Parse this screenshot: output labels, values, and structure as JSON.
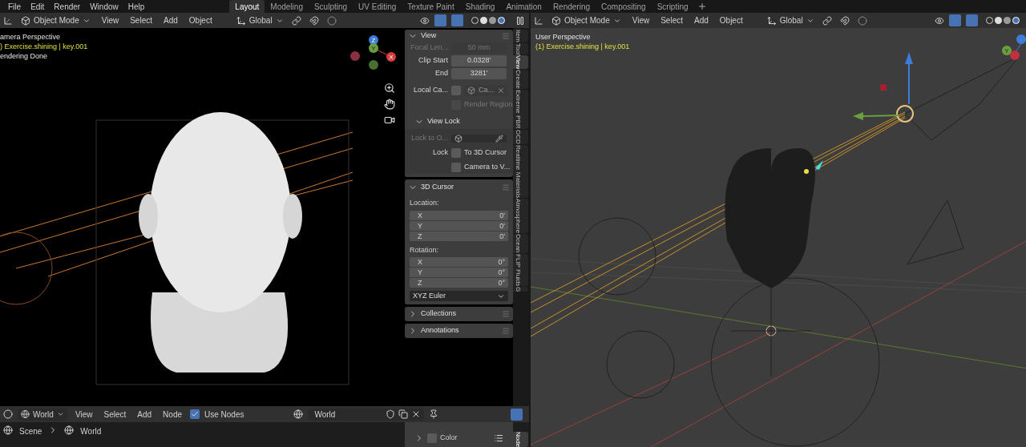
{
  "menu": [
    "File",
    "Edit",
    "Render",
    "Window",
    "Help"
  ],
  "workspaces": [
    {
      "label": "Layout",
      "selected": true
    },
    {
      "label": "Modeling",
      "selected": false
    },
    {
      "label": "Sculpting",
      "selected": false
    },
    {
      "label": "UV Editing",
      "selected": false
    },
    {
      "label": "Texture Paint",
      "selected": false
    },
    {
      "label": "Shading",
      "selected": false
    },
    {
      "label": "Animation",
      "selected": false
    },
    {
      "label": "Rendering",
      "selected": false
    },
    {
      "label": "Compositing",
      "selected": false
    },
    {
      "label": "Scripting",
      "selected": false
    }
  ],
  "left_viewport": {
    "header": {
      "mode": "Object Mode",
      "menus": [
        "View",
        "Select",
        "Add",
        "Object"
      ],
      "orientation": "Global"
    },
    "overlay": [
      {
        "kind": "title",
        "text": "amera Perspective"
      },
      {
        "kind": "object",
        "text": ") Exercise.shining | key.001"
      },
      {
        "kind": "status",
        "text": "endering Done"
      }
    ],
    "gizmo_axes": [
      "Z",
      "Y",
      "X"
    ]
  },
  "sidebar": {
    "tabs": [
      {
        "label": "Item",
        "selected": false
      },
      {
        "label": "Tool",
        "selected": false
      },
      {
        "label": "View",
        "selected": true
      },
      {
        "label": "Create",
        "selected": false
      },
      {
        "label": "Extreme PBR",
        "selected": false
      },
      {
        "label": "OCD",
        "selected": false
      },
      {
        "label": "Realtime Materials",
        "selected": false
      },
      {
        "label": "Atmosphere",
        "selected": false
      },
      {
        "label": "Ocean",
        "selected": false
      },
      {
        "label": "FLIP Fluids",
        "selected": false
      },
      {
        "label": "G",
        "selected": false
      }
    ],
    "view_panel": {
      "title": "View",
      "expanded": true,
      "rows": [
        {
          "kind": "field",
          "label": "Focal Len...",
          "value": "50 mm",
          "disabled": true
        },
        {
          "kind": "field",
          "label": "Clip Start",
          "value": "0.0328'",
          "disabled": false
        },
        {
          "kind": "field",
          "label": "End",
          "value": "3281'",
          "disabled": false
        },
        {
          "kind": "object",
          "label": "Local Ca...",
          "checked": false,
          "value": "Ca..."
        },
        {
          "kind": "checkbox",
          "text": "Render Region",
          "checked": false,
          "disabled": true
        }
      ],
      "view_lock": {
        "title": "View Lock",
        "expanded": true,
        "rows": [
          {
            "kind": "picker",
            "label": "Lock to O...",
            "disabled": true
          },
          {
            "kind": "checkbox",
            "label": "Lock",
            "text": "To 3D Cursor",
            "checked": false,
            "disabled": false
          },
          {
            "kind": "checkbox",
            "text": "Camera to V...",
            "checked": false,
            "disabled": false
          }
        ]
      }
    },
    "cursor_panel": {
      "title": "3D Cursor",
      "expanded": true,
      "groups": [
        {
          "label": "Location:",
          "rows": [
            {
              "axis": "X",
              "value": "0'"
            },
            {
              "axis": "Y",
              "value": "0'"
            },
            {
              "axis": "Z",
              "value": "0'"
            }
          ]
        },
        {
          "label": "Rotation:",
          "rows": [
            {
              "axis": "X",
              "value": "0°"
            },
            {
              "axis": "Y",
              "value": "0°"
            },
            {
              "axis": "Z",
              "value": "0°"
            }
          ]
        }
      ],
      "rotation_mode": "XYZ Euler"
    },
    "collapsed_panels": [
      {
        "title": "Collections",
        "expanded": false
      },
      {
        "title": "Annotations",
        "expanded": false
      }
    ]
  },
  "node_editor": {
    "world_selector": "World",
    "menus": [
      "View",
      "Select",
      "Add",
      "Node"
    ],
    "use_nodes": {
      "label": "Use Nodes",
      "checked": true
    },
    "world_field": "World",
    "breadcrumb": [
      "Scene",
      "World"
    ],
    "sidebar_row": {
      "label": "Color",
      "expanded": false,
      "checked": false
    },
    "sidebar_tab": {
      "label": "Node",
      "selected": true
    }
  },
  "right_viewport": {
    "header": {
      "mode": "Object Mode",
      "menus": [
        "View",
        "Select",
        "Add",
        "Object"
      ],
      "orientation": "Global"
    },
    "overlay": [
      {
        "kind": "title",
        "text": "User Perspective"
      },
      {
        "kind": "object",
        "text": "(1) Exercise.shining | key.001"
      }
    ],
    "gizmo_axes": [
      "Y"
    ]
  }
}
